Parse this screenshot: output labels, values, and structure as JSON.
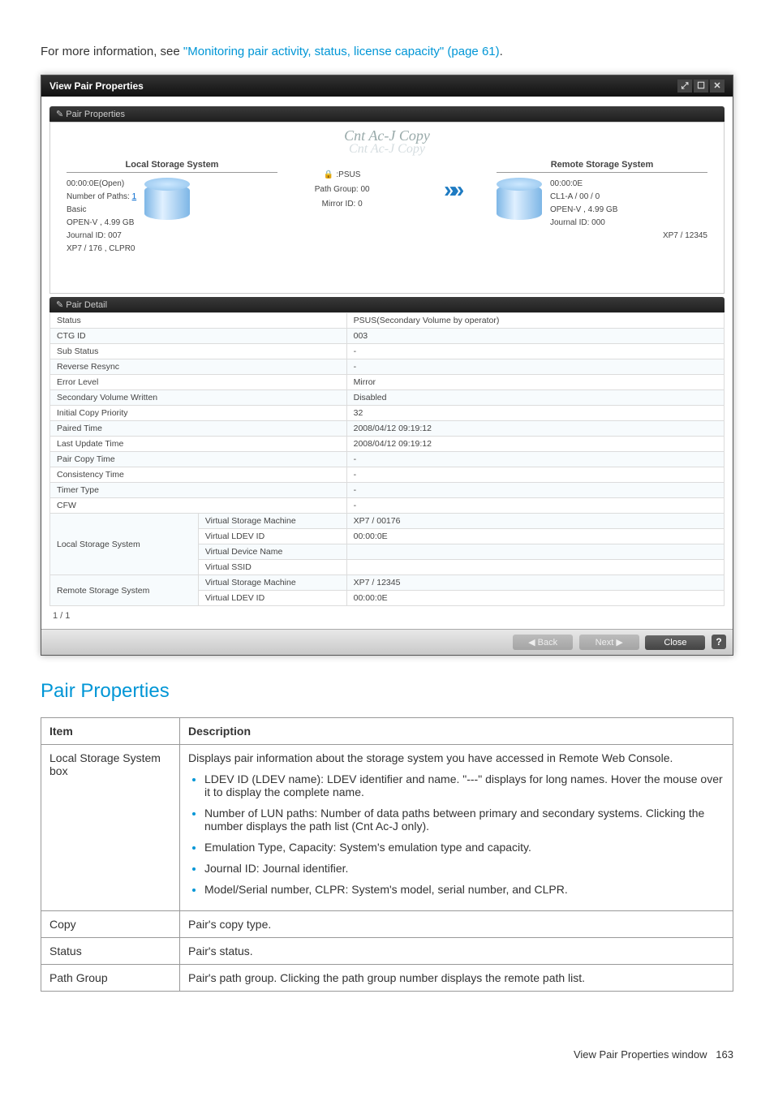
{
  "intro": {
    "prefix": "For more information, see ",
    "link": "\"Monitoring pair activity, status, license capacity\" (page 61)",
    "suffix": "."
  },
  "dialog": {
    "title": "View Pair Properties",
    "sectionProperties": "✎ Pair Properties",
    "copyTitle": "Cnt Ac-J Copy",
    "copyTitleShadow": "Cnt Ac-J Copy",
    "local": {
      "header": "Local Storage System",
      "ldev": "00:00:0E(Open)",
      "pathsLabel": "Number of Paths:",
      "pathsVal": "1",
      "emu": "Basic",
      "cap": "OPEN-V , 4.99 GB",
      "journal": "Journal ID:  007",
      "footer": "XP7 / 176 , CLPR0"
    },
    "mid": {
      "status": ":PSUS",
      "pgLabel": "Path Group:",
      "pgVal": "00",
      "mirror": "Mirror ID: 0"
    },
    "remote": {
      "header": "Remote Storage System",
      "ldev": "00:00:0E",
      "port": "CL1-A / 00 / 0",
      "cap": "OPEN-V , 4.99 GB",
      "journal": "Journal ID:   000",
      "footer": "XP7 / 12345"
    },
    "sectionDetail": "✎ Pair Detail",
    "details": [
      {
        "k": "Status",
        "v": "PSUS(Secondary Volume by operator)"
      },
      {
        "k": "CTG ID",
        "v": "003"
      },
      {
        "k": "Sub Status",
        "v": "-"
      },
      {
        "k": "Reverse Resync",
        "v": "-"
      },
      {
        "k": "Error Level",
        "v": "Mirror"
      },
      {
        "k": "Secondary Volume Written",
        "v": "Disabled"
      },
      {
        "k": "Initial Copy Priority",
        "v": "32"
      },
      {
        "k": "Paired Time",
        "v": "2008/04/12 09:19:12"
      },
      {
        "k": "Last Update Time",
        "v": "2008/04/12 09:19:12"
      },
      {
        "k": "Pair Copy Time",
        "v": "-"
      },
      {
        "k": "Consistency Time",
        "v": "-"
      },
      {
        "k": "Timer Type",
        "v": "-"
      },
      {
        "k": "CFW",
        "v": "-"
      }
    ],
    "localSys": {
      "k": "Local Storage System",
      "r0k": "Virtual Storage Machine",
      "r0v": "XP7 / 00176",
      "r1k": "Virtual LDEV ID",
      "r1v": "00:00:0E",
      "r2k": "Virtual Device Name",
      "r2v": "",
      "r3k": "Virtual SSID",
      "r3v": ""
    },
    "remoteSys": {
      "k": "Remote Storage System",
      "r0k": "Virtual Storage Machine",
      "r0v": "XP7 / 12345",
      "r1k": "Virtual LDEV ID",
      "r1v": "00:00:0E"
    },
    "pager": "1 / 1",
    "footer": {
      "back": "◀ Back",
      "next": "Next ▶",
      "close": "Close",
      "help": "?"
    }
  },
  "doc": {
    "heading": "Pair Properties",
    "headerItem": "Item",
    "headerDesc": "Description",
    "rows": {
      "r0item": "Local Storage System box",
      "r0lead": "Displays pair information about the storage system you have accessed in Remote Web Console.",
      "r0b1": "LDEV ID (LDEV name): LDEV identifier and name. \"---\" displays for long names. Hover the mouse over it to display the complete name.",
      "r0b2": "Number of LUN paths: Number of data paths between primary and secondary systems. Clicking the number displays the path list (Cnt Ac-J only).",
      "r0b3": "Emulation Type, Capacity: System's emulation type and capacity.",
      "r0b4": "Journal ID: Journal identifier.",
      "r0b5": "Model/Serial number, CLPR: System's model, serial number, and CLPR.",
      "r1item": "Copy",
      "r1desc": "Pair's copy type.",
      "r2item": "Status",
      "r2desc": "Pair's status.",
      "r3item": "Path Group",
      "r3desc": "Pair's path group. Clicking the path group number displays the remote path list."
    }
  },
  "pageFooter": {
    "label": "View Pair Properties window",
    "num": "163"
  }
}
